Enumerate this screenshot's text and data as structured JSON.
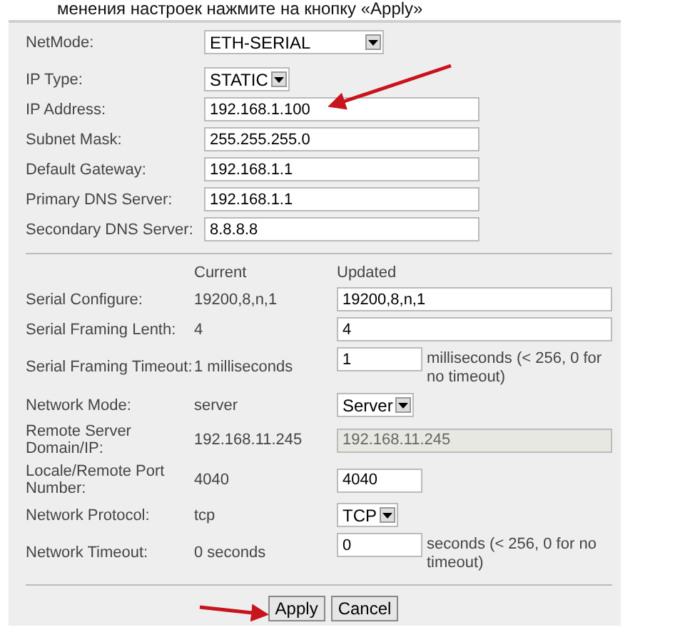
{
  "header_note": "менения настроек нажмите на кнопку «Apply»",
  "network": {
    "fields": [
      {
        "label": "NetMode:",
        "kind": "select-wide",
        "value": "ETH-SERIAL"
      },
      {
        "label": "IP Type:",
        "kind": "select",
        "value": "STATIC"
      },
      {
        "label": "IP Address:",
        "kind": "text",
        "value": "192.168.1.100"
      },
      {
        "label": "Subnet Mask:",
        "kind": "text",
        "value": "255.255.255.0"
      },
      {
        "label": "Default Gateway:",
        "kind": "text",
        "value": "192.168.1.1"
      },
      {
        "label": "Primary DNS Server:",
        "kind": "text",
        "value": "192.168.1.1"
      },
      {
        "label": "Secondary DNS Server:",
        "kind": "text",
        "value": "8.8.8.8"
      }
    ]
  },
  "serial": {
    "columns": [
      "Current",
      "Updated"
    ],
    "rows": [
      {
        "label": "Serial Configure:",
        "current": "19200,8,n,1",
        "kind": "text",
        "value": "19200,8,n,1",
        "disabled": false
      },
      {
        "label": "Serial Framing Lenth:",
        "current": "4",
        "kind": "text",
        "value": "4",
        "disabled": false
      },
      {
        "label": "Serial Framing Timeout:",
        "current": "1 milliseconds",
        "kind": "short-text",
        "value": "1",
        "note": "milliseconds (< 256, 0 for no timeout)",
        "disabled": false
      },
      {
        "label": "Network Mode:",
        "current": "server",
        "kind": "select",
        "value": "Server",
        "disabled": false
      },
      {
        "label": "Remote Server Domain/IP:",
        "current": "192.168.11.245",
        "kind": "text",
        "value": "192.168.11.245",
        "disabled": true
      },
      {
        "label": "Locale/Remote Port Number:",
        "current": "4040",
        "kind": "short-text",
        "value": "4040",
        "disabled": false
      },
      {
        "label": "Network Protocol:",
        "current": "tcp",
        "kind": "select",
        "value": "TCP",
        "disabled": false
      },
      {
        "label": "Network Timeout:",
        "current": "0 seconds",
        "kind": "short-text",
        "value": "0",
        "note": "seconds (< 256, 0 for no timeout)",
        "disabled": false
      }
    ]
  },
  "buttons": [
    {
      "label": "Apply"
    },
    {
      "label": "Cancel"
    }
  ]
}
